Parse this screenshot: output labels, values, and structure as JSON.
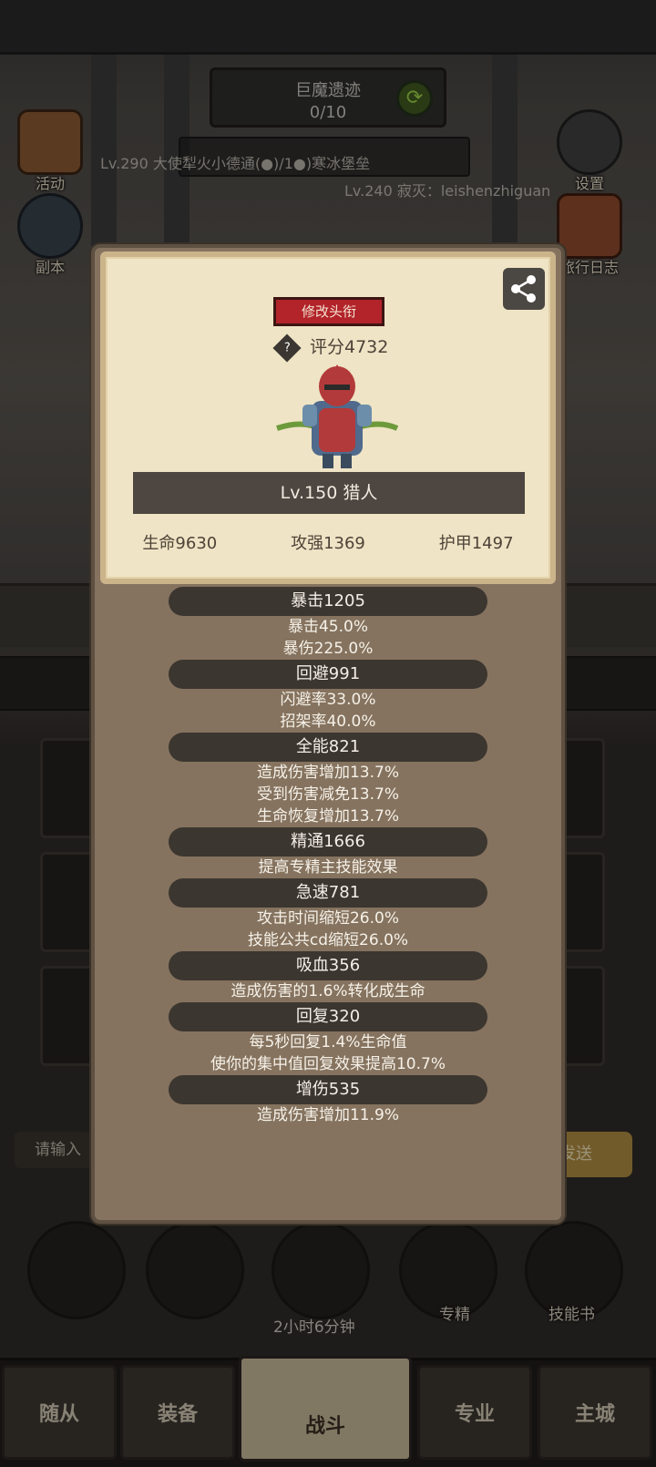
{
  "background": {
    "dungeon": {
      "name": "巨魔遗迹",
      "progress": "0/10"
    },
    "announcement": "Lv.290 大使犁火小德通(●)/1●)寒冰堡垒",
    "second_player": "Lv.240 寂灭：leishenzhiguan",
    "left_icons": [
      {
        "label": "活动",
        "icon": "scroll-icon"
      },
      {
        "label": "副本",
        "icon": "portal-icon"
      }
    ],
    "right_icons": [
      {
        "label": "设置",
        "icon": "gear-icon"
      },
      {
        "label": "旅行日志",
        "icon": "journal-icon"
      }
    ],
    "chat": {
      "input_placeholder": "请输入",
      "send_label": "发送"
    },
    "bottom_tools": [
      {
        "label": "",
        "icon": "potion-icon"
      },
      {
        "label": "",
        "icon": "bread-icon"
      },
      {
        "label": "",
        "icon": "chest-icon"
      },
      {
        "label": "专精",
        "icon": "talent-icon"
      },
      {
        "label": "技能书",
        "icon": "skillbook-icon"
      }
    ],
    "timer": "2小时6分钟",
    "nav_tabs": [
      {
        "label": "随从"
      },
      {
        "label": "装备"
      },
      {
        "label": "战斗",
        "active": true
      },
      {
        "label": "专业"
      },
      {
        "label": "主城"
      }
    ]
  },
  "popup": {
    "title_button": "修改头衔",
    "score": "评分4732",
    "character_name": "Lv.150 猎人",
    "base_stats": {
      "hp": "生命9630",
      "attack": "攻强1369",
      "armor": "护甲1497"
    },
    "stat_groups": [
      {
        "header": "暴击1205",
        "lines": [
          "暴击45.0%",
          "暴伤225.0%"
        ]
      },
      {
        "header": "回避991",
        "lines": [
          "闪避率33.0%",
          "招架率40.0%"
        ]
      },
      {
        "header": "全能821",
        "lines": [
          "造成伤害增加13.7%",
          "受到伤害减免13.7%",
          "生命恢复增加13.7%"
        ]
      },
      {
        "header": "精通1666",
        "lines": [
          "提高专精主技能效果"
        ]
      },
      {
        "header": "急速781",
        "lines": [
          "攻击时间缩短26.0%",
          "技能公共cd缩短26.0%"
        ]
      },
      {
        "header": "吸血356",
        "lines": [
          "造成伤害的1.6%转化成生命"
        ]
      },
      {
        "header": "回复320",
        "lines": [
          "每5秒回复1.4%生命值",
          "使你的集中值回复效果提高10.7%"
        ]
      },
      {
        "header": "增伤535",
        "lines": [
          "造成伤害增加11.9%"
        ]
      }
    ]
  }
}
